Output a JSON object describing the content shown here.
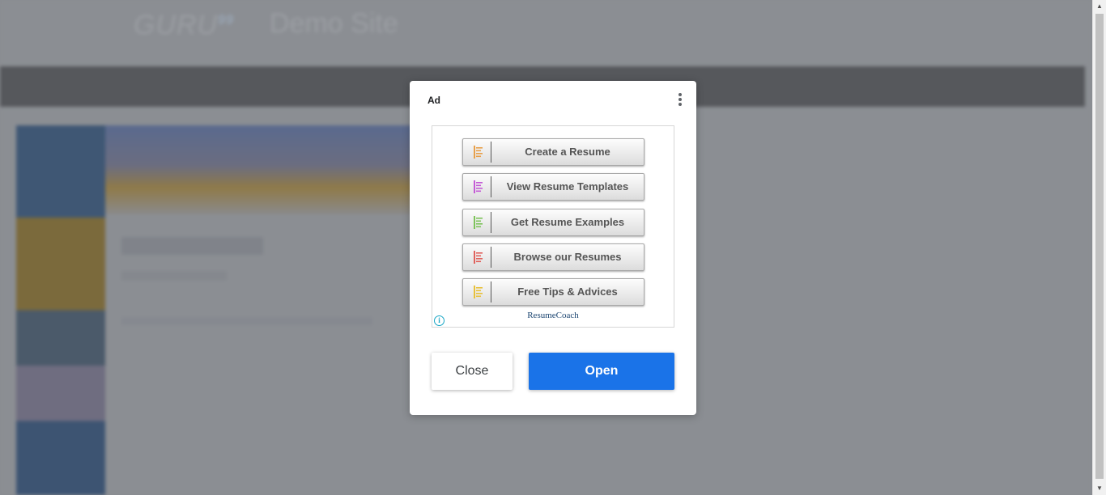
{
  "background": {
    "logo": "GURU",
    "logo_sup": "99",
    "site_title": "Demo Site"
  },
  "modal": {
    "label": "Ad",
    "close_label": "Close",
    "open_label": "Open",
    "menu_icon": "more-vert-icon"
  },
  "ad": {
    "buttons": [
      {
        "label": "Create a Resume",
        "color": "#e8a04a"
      },
      {
        "label": "View Resume Templates",
        "color": "#c45bd6"
      },
      {
        "label": "Get Resume Examples",
        "color": "#7dc35a"
      },
      {
        "label": "Browse our Resumes",
        "color": "#e0615c"
      },
      {
        "label": "Free Tips & Advices",
        "color": "#e8c13a"
      }
    ],
    "brand": "ResumeCoach",
    "info_icon": "info-icon",
    "info_glyph": "i"
  },
  "colors": {
    "primary": "#1a73e8"
  }
}
